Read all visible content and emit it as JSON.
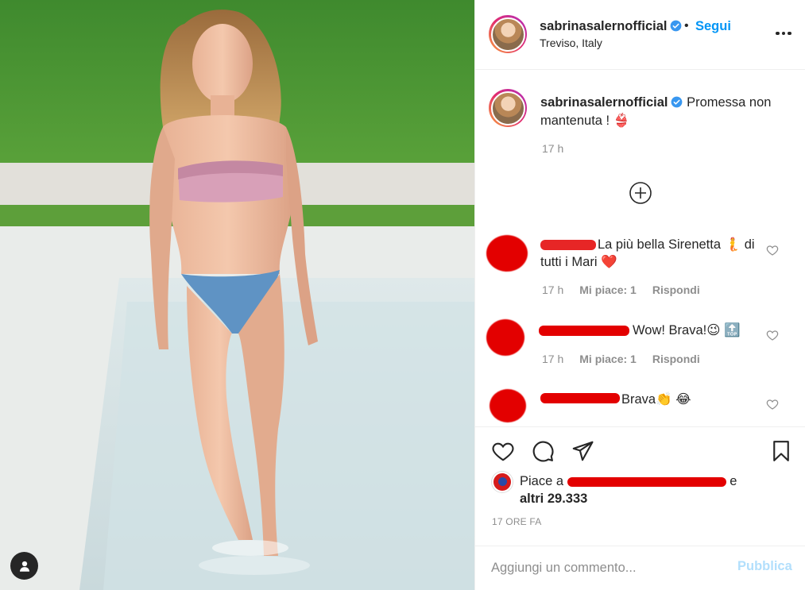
{
  "post": {
    "username": "sabrinasalernofficial",
    "follow_label": "Segui",
    "separator": "•",
    "location": "Treviso, Italy",
    "caption": "Promessa non mantenuta ! 👙",
    "caption_time": "17 h",
    "likes_prefix": "Piace a",
    "likes_suffix": "e",
    "likes_others": "altri 29.333",
    "time_ago": "17 ORE FA"
  },
  "comments": [
    {
      "text": "La più bella Sirenetta 🧜 di tutti i Mari ❤️",
      "time": "17 h",
      "likes": "Mi piace: 1",
      "reply": "Rispondi"
    },
    {
      "text": "Wow! Brava!😉 🔝",
      "time": "17 h",
      "likes": "Mi piace: 1",
      "reply": "Rispondi"
    },
    {
      "text": "Brava👏 😂"
    }
  ],
  "composer": {
    "placeholder": "Aggiungi un commento...",
    "publish_label": "Pubblica"
  },
  "icons": {
    "verified": "verified-badge-icon",
    "more": "more-options-icon",
    "load_more": "plus-circle-icon",
    "like": "heart-icon",
    "comment": "comment-icon",
    "share": "send-icon",
    "save": "bookmark-icon",
    "user_tag": "user-icon"
  },
  "colors": {
    "accent": "#0095f6",
    "publish_disabled": "#b2dffc",
    "muted": "#8e8e8e",
    "redaction": "#e30000"
  }
}
